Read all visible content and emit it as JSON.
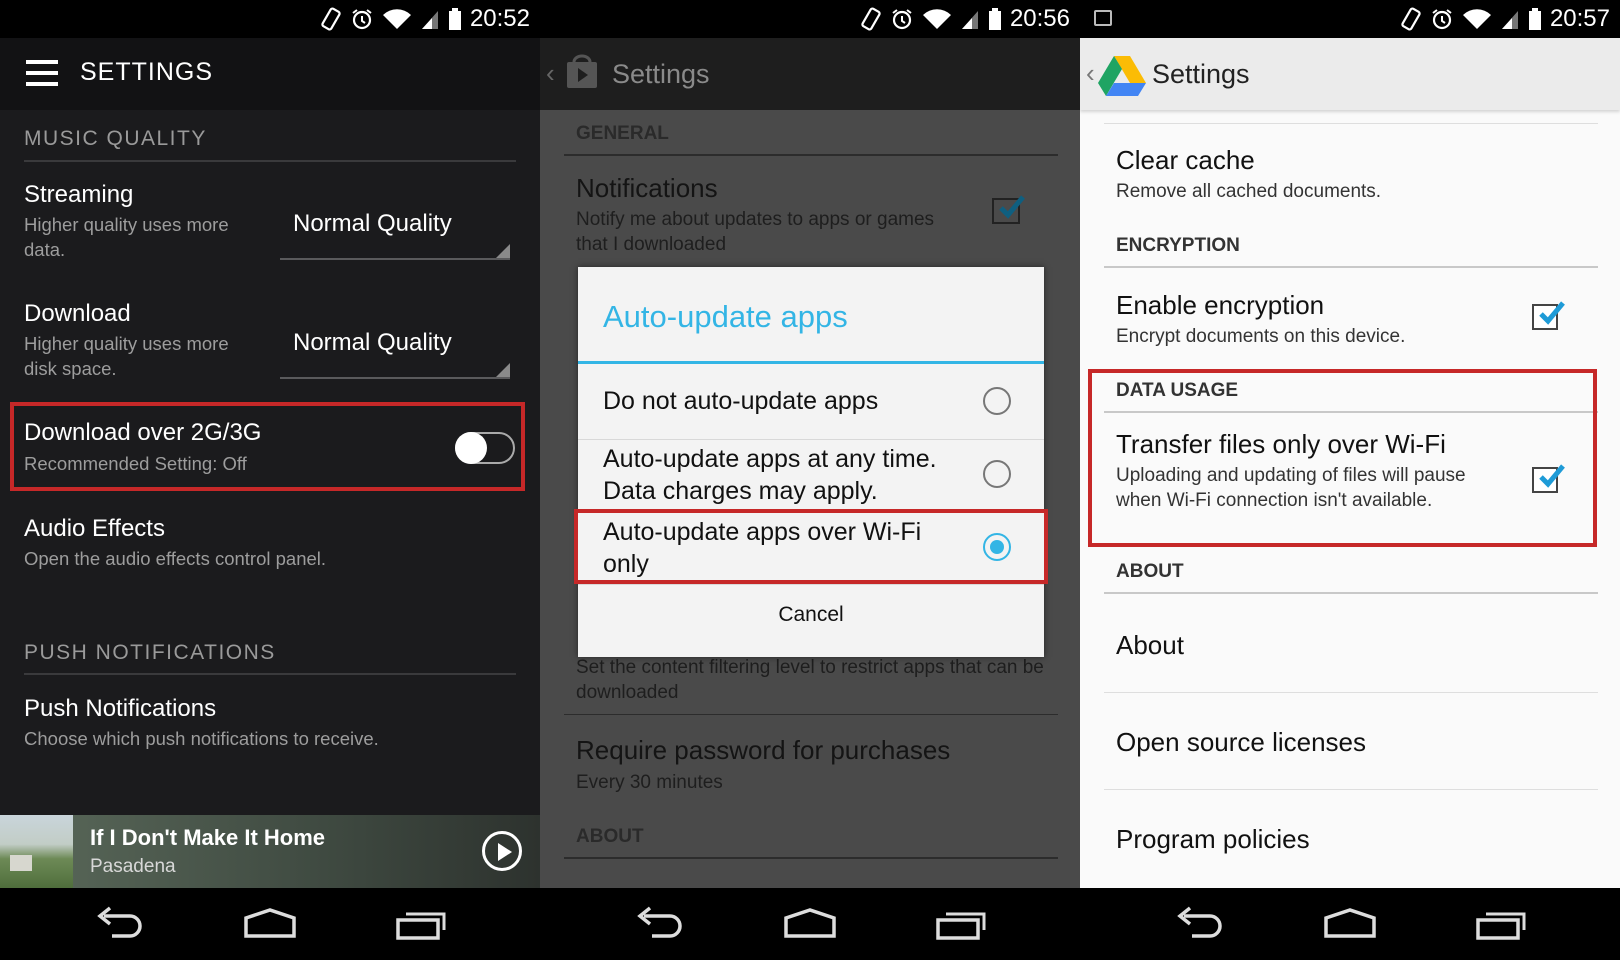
{
  "spotify": {
    "status_time": "20:52",
    "title": "SETTINGS",
    "music_quality_header": "MUSIC QUALITY",
    "streaming": {
      "title": "Streaming",
      "subtitle": "Higher quality uses more data.",
      "value": "Normal Quality"
    },
    "download": {
      "title": "Download",
      "subtitle": "Higher quality uses more disk space.",
      "value": "Normal Quality"
    },
    "download_over_mobile": {
      "title": "Download over 2G/3G",
      "subtitle": "Recommended Setting: Off",
      "enabled": false
    },
    "audio_effects": {
      "title": "Audio Effects",
      "subtitle": "Open the audio effects control panel."
    },
    "push_header": "PUSH NOTIFICATIONS",
    "push": {
      "title": "Push Notifications",
      "subtitle": "Choose which push notifications to receive."
    },
    "now_playing": {
      "title": "If I Don't Make It Home",
      "artist": "Pasadena"
    },
    "highlight_color": "#c62828"
  },
  "playstore": {
    "status_time": "20:56",
    "title": "Settings",
    "general_header": "GENERAL",
    "notifications": {
      "title": "Notifications",
      "subtitle": "Notify me about updates to apps or games that I downloaded",
      "checked": true
    },
    "dialog": {
      "title": "Auto-update apps",
      "options": [
        {
          "label": "Do not auto-update apps",
          "selected": false
        },
        {
          "label": "Auto-update apps at any time. Data charges may apply.",
          "selected": false
        },
        {
          "label": "Auto-update apps over Wi-Fi only",
          "selected": true
        }
      ],
      "cancel": "Cancel",
      "accent": "#33b5e5"
    },
    "content_filter_sub": "Set the content filtering level to restrict apps that can be downloaded",
    "password": {
      "title": "Require password for purchases",
      "subtitle": "Every 30 minutes"
    },
    "about_header": "ABOUT"
  },
  "drive": {
    "status_time": "20:57",
    "title": "Settings",
    "clear_cache": {
      "title": "Clear cache",
      "subtitle": "Remove all cached documents."
    },
    "encryption_header": "ENCRYPTION",
    "encryption": {
      "title": "Enable encryption",
      "subtitle": "Encrypt documents on this device.",
      "checked": true
    },
    "data_usage_header": "DATA USAGE",
    "wifi_only": {
      "title": "Transfer files only over Wi-Fi",
      "subtitle": "Uploading and updating of files will pause when Wi-Fi connection isn't available.",
      "checked": true
    },
    "about_header": "ABOUT",
    "about": "About",
    "licenses": "Open source licenses",
    "policies": "Program policies",
    "check_color": "#1e9bd7"
  }
}
